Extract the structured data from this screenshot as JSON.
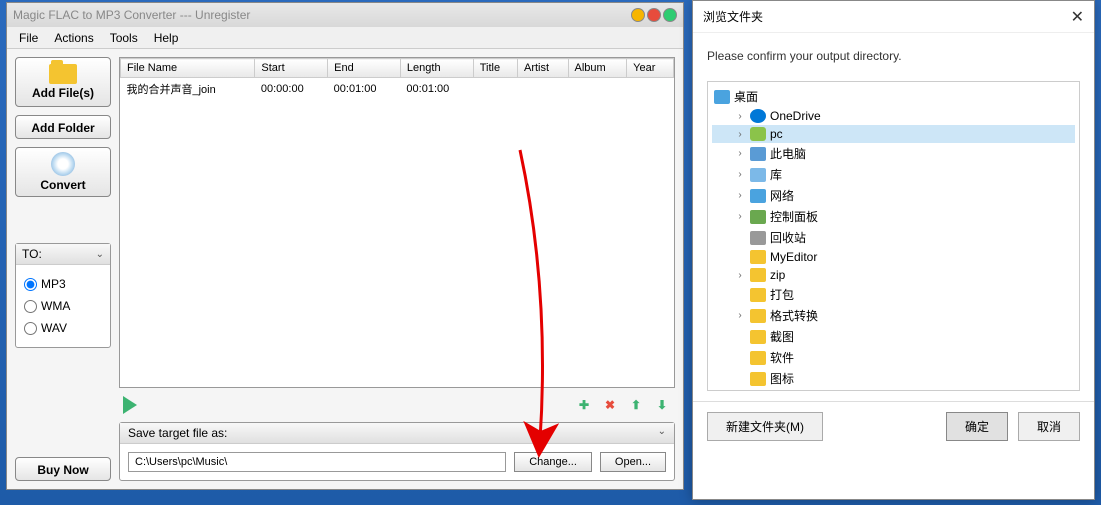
{
  "window": {
    "title": "Magic FLAC to MP3 Converter --- Unregister"
  },
  "menu": {
    "file": "File",
    "actions": "Actions",
    "tools": "Tools",
    "help": "Help"
  },
  "buttons": {
    "add_files": "Add File(s)",
    "add_folder": "Add Folder",
    "convert": "Convert",
    "buy_now": "Buy Now",
    "change": "Change...",
    "open": "Open..."
  },
  "to_panel": {
    "title": "TO:",
    "options": [
      "MP3",
      "WMA",
      "WAV"
    ],
    "selected": "MP3"
  },
  "table": {
    "headers": [
      "File Name",
      "Start",
      "End",
      "Length",
      "Title",
      "Artist",
      "Album",
      "Year"
    ],
    "rows": [
      {
        "filename": "我的合并声音_join",
        "start": "00:00:00",
        "end": "00:01:00",
        "length": "00:01:00",
        "title": "",
        "artist": "",
        "album": "",
        "year": ""
      }
    ]
  },
  "save": {
    "label": "Save target file as:",
    "path": "C:\\Users\\pc\\Music\\"
  },
  "dialog": {
    "title": "浏览文件夹",
    "message": "Please confirm your output directory.",
    "tree": {
      "root": "桌面",
      "items": [
        {
          "label": "OneDrive",
          "icon": "cloud",
          "indent": 1,
          "arrow": true
        },
        {
          "label": "pc",
          "icon": "user",
          "indent": 1,
          "arrow": true,
          "selected": true
        },
        {
          "label": "此电脑",
          "icon": "pc",
          "indent": 1,
          "arrow": true
        },
        {
          "label": "库",
          "icon": "lib",
          "indent": 1,
          "arrow": true
        },
        {
          "label": "网络",
          "icon": "net",
          "indent": 1,
          "arrow": true
        },
        {
          "label": "控制面板",
          "icon": "cp",
          "indent": 1,
          "arrow": true
        },
        {
          "label": "回收站",
          "icon": "bin",
          "indent": 1,
          "arrow": false
        },
        {
          "label": "MyEditor",
          "icon": "folder",
          "indent": 1,
          "arrow": false
        },
        {
          "label": "zip",
          "icon": "folder",
          "indent": 1,
          "arrow": true
        },
        {
          "label": "打包",
          "icon": "folder",
          "indent": 1,
          "arrow": false
        },
        {
          "label": "格式转换",
          "icon": "folder",
          "indent": 1,
          "arrow": true
        },
        {
          "label": "截图",
          "icon": "folder",
          "indent": 1,
          "arrow": false
        },
        {
          "label": "软件",
          "icon": "folder",
          "indent": 1,
          "arrow": false
        },
        {
          "label": "图标",
          "icon": "folder",
          "indent": 1,
          "arrow": false
        }
      ]
    },
    "new_folder": "新建文件夹(M)",
    "ok": "确定",
    "cancel": "取消"
  }
}
